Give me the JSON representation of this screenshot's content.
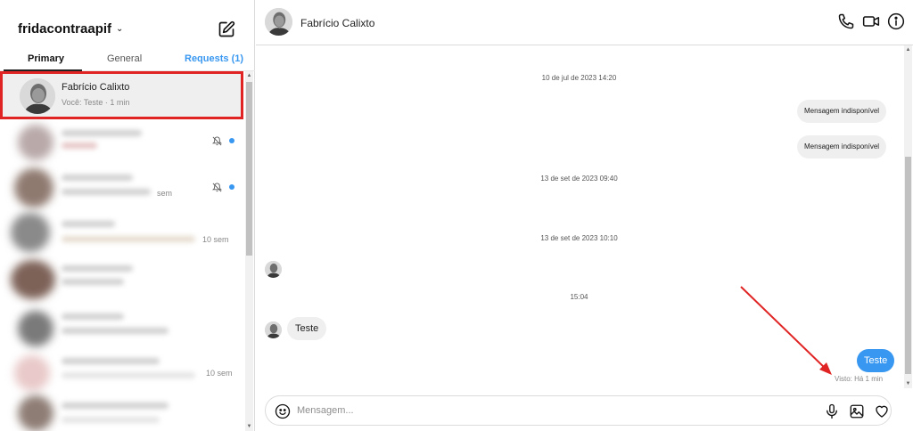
{
  "sidebar": {
    "account_name": "fridacontraapif",
    "tabs": {
      "primary": "Primary",
      "general": "General",
      "requests": "Requests (1)"
    },
    "active_conversation": {
      "name": "Fabrício Calixto",
      "preview": "Você: Teste · 1 min"
    },
    "blurred_times": [
      "sem",
      "10 sem",
      "10 sem"
    ]
  },
  "chat": {
    "contact_name": "Fabrício Calixto",
    "timestamps": [
      "10 de jul de 2023 14:20",
      "13 de set de 2023 09:40",
      "13 de set de 2023 10:10",
      "15:04"
    ],
    "unavailable_1": "Mensagem indisponível",
    "unavailable_2": "Mensagem indisponível",
    "received_text": "Teste",
    "sent_text": "Teste",
    "seen_status": "Visto: Há 1 min",
    "composer_placeholder": "Mensagem..."
  },
  "colors": {
    "accent_blue": "#3897f0",
    "highlight_red": "#e02424"
  }
}
